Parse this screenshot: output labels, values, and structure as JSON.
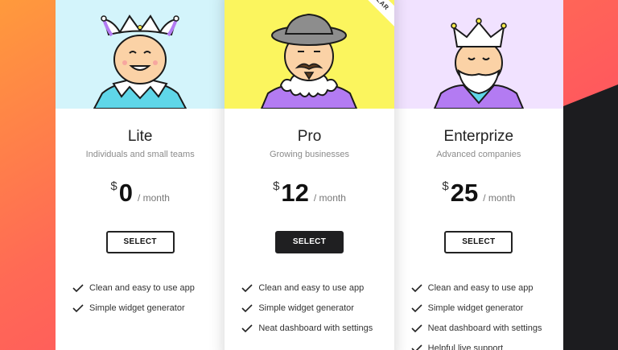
{
  "colors": {
    "lite_hero": "#d3f4fb",
    "pro_hero": "#fbf55e",
    "enterprise_hero": "#f1e2ff",
    "dark_button": "#1f1f21",
    "dark_background": "#1c1c1f"
  },
  "plans": [
    {
      "name": "Lite",
      "description": "Individuals and small teams",
      "currency": "$",
      "amount": "0",
      "period": "/ month",
      "button": "SELECT",
      "features": [
        "Clean and easy to use app",
        "Simple widget generator"
      ]
    },
    {
      "name": "Pro",
      "description": "Growing businesses",
      "currency": "$",
      "amount": "12",
      "period": "/ month",
      "button": "SELECT",
      "ribbon": "ULAR",
      "features": [
        "Clean and easy to use app",
        "Simple widget generator",
        "Neat dashboard with settings"
      ]
    },
    {
      "name": "Enterprize",
      "description": "Advanced companies",
      "currency": "$",
      "amount": "25",
      "period": "/ month",
      "button": "SELECT",
      "features": [
        "Clean and easy to use app",
        "Simple widget generator",
        "Neat dashboard with settings",
        "Helpful live support"
      ]
    }
  ],
  "icons": [
    "jester-avatar-icon",
    "nobleman-avatar-icon",
    "king-avatar-icon",
    "check-icon"
  ]
}
